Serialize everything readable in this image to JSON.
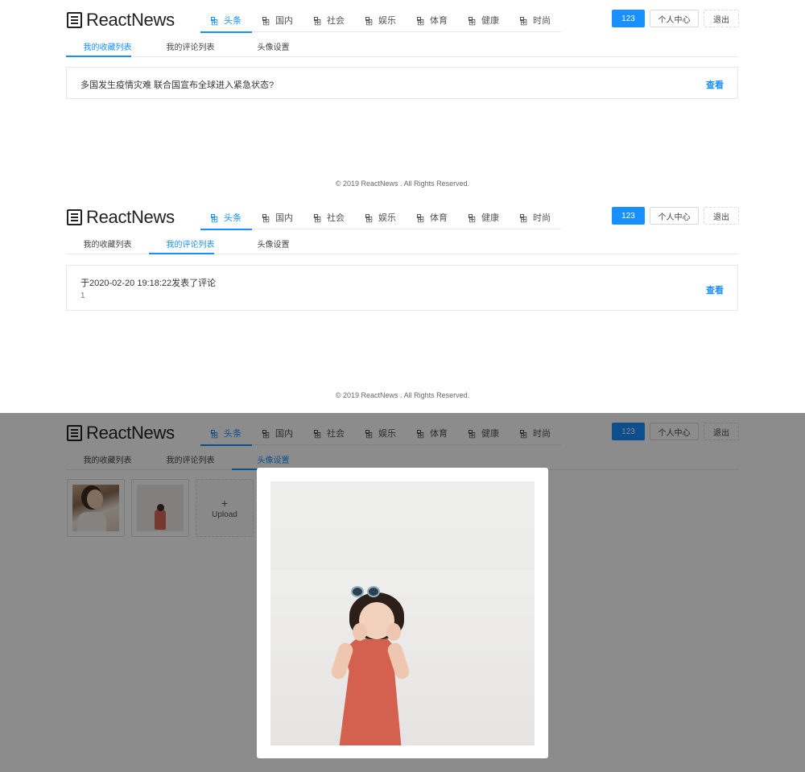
{
  "header": {
    "logo_text": "ReactNews",
    "nav": [
      "头条",
      "国内",
      "社会",
      "娱乐",
      "体育",
      "健康",
      "时尚"
    ],
    "user_button": "123",
    "center_button": "个人中心",
    "logout_button": "退出"
  },
  "tabs": [
    "我的收藏列表",
    "我的评论列表",
    "头像设置"
  ],
  "favorites": {
    "items": [
      {
        "title": "多国发生疫情灾难 联合国宣布全球进入紧急状态?",
        "link": "查看"
      }
    ]
  },
  "comments": {
    "items": [
      {
        "title": "于2020-02-20 19:18:22发表了评论",
        "content": "1",
        "link": "查看"
      }
    ]
  },
  "avatar": {
    "upload_label": "Upload",
    "upload_plus": "+"
  },
  "footer": "© 2019 ReactNews . All Rights Reserved.",
  "colors": {
    "accent": "#1890ff"
  }
}
